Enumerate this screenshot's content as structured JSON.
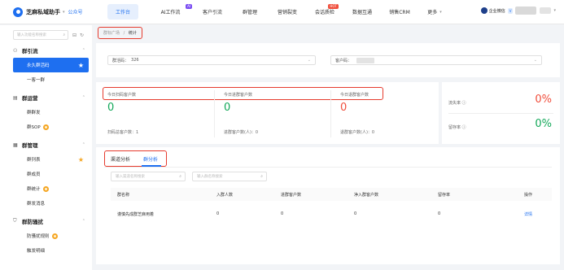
{
  "app": {
    "name": "芝麻私域助手",
    "company": "公众号"
  },
  "nav": [
    {
      "label": "工作台",
      "active": true
    },
    {
      "label": "AI工作流",
      "badge": "AI"
    },
    {
      "label": "客户引流"
    },
    {
      "label": "群管理"
    },
    {
      "label": "营销裂变"
    },
    {
      "label": "会话质检",
      "badge": "HOT"
    },
    {
      "label": "数据互通"
    },
    {
      "label": "销售CRM"
    },
    {
      "label": "更多"
    }
  ],
  "user": {
    "name": "企业微信",
    "tag": "V"
  },
  "sidebar": {
    "search_placeholder": "输入功能名称搜索",
    "groups": [
      {
        "label": "群引流",
        "icon": "share-icon",
        "items": [
          {
            "label": "永久群活码",
            "active": true,
            "starred": true
          },
          {
            "label": "一客一群"
          }
        ]
      },
      {
        "label": "群运营",
        "icon": "chat-icon",
        "items": [
          {
            "label": "群群发"
          },
          {
            "label": "群SOP",
            "hot": true
          }
        ]
      },
      {
        "label": "群管理",
        "icon": "group-icon",
        "items": [
          {
            "label": "群列表",
            "starred": true
          },
          {
            "label": "群成员"
          },
          {
            "label": "群统计",
            "hot": true
          },
          {
            "label": "群发消息"
          }
        ]
      },
      {
        "label": "群防骚扰",
        "icon": "shield-icon",
        "items": [
          {
            "label": "防骚扰规则",
            "hot": true
          },
          {
            "label": "触发明细"
          }
        ]
      }
    ]
  },
  "breadcrumb": {
    "parent": "群标广场",
    "separator": "/",
    "current": "统计"
  },
  "filters": {
    "group_code_label": "群活码：",
    "group_code_value": "326",
    "channel_label": "客户码："
  },
  "stats": {
    "today_joined_label": "今日扫码客户数",
    "today_joined_value": "0",
    "today_entered_label": "今日进群客户数",
    "today_entered_value": "0",
    "today_left_label": "今日退群客户数",
    "today_left_value": "0",
    "total_scanned_label": "扫码总客户数：",
    "total_scanned_value": "1",
    "total_entered_label": "进群客户数(人)：",
    "total_entered_value": "0",
    "total_left_label": "退群客户数(人)：",
    "total_left_value": "0",
    "churn_label": "流失率 ⓘ",
    "churn_value": "0%",
    "retain_label": "留存率 ⓘ",
    "retain_value": "0%",
    "churn_color": "#f04e3c",
    "retain_color": "#14a85a"
  },
  "tabs": [
    {
      "label": "渠道分析"
    },
    {
      "label": "群分析",
      "active": true
    }
  ],
  "search": {
    "channel_placeholder": "输入渠道名称搜索",
    "group_placeholder": "输入群名称搜索"
  },
  "table": {
    "headers": [
      "群名称",
      "入群人数",
      "进群客户数",
      "净入群客户数",
      "留存率",
      "操作"
    ],
    "rows": [
      [
        "谨慎先成群芝麻用着",
        "0",
        "0",
        "0",
        "0",
        "详情"
      ]
    ]
  }
}
